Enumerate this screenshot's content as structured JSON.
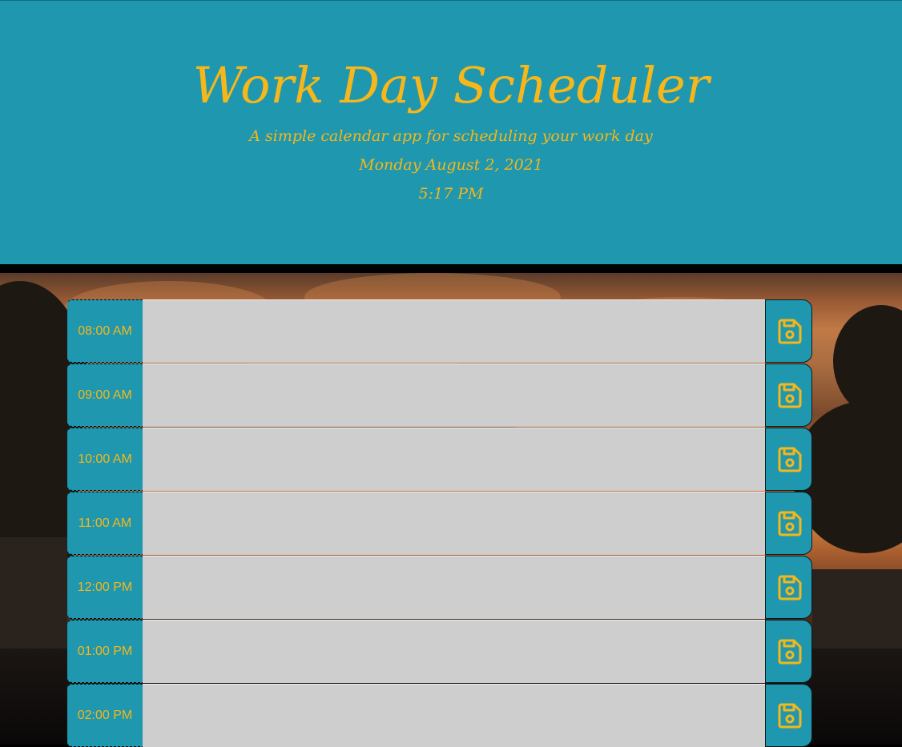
{
  "header": {
    "title": "Work Day Scheduler",
    "subtitle": "A simple calendar app for scheduling your work day",
    "date": "Monday August 2, 2021",
    "time": "5:17 PM"
  },
  "colors": {
    "accent": "#1f97ae",
    "text": "#f5b71b",
    "textarea": "#cecece"
  },
  "time_blocks": [
    {
      "hour": "08:00 AM",
      "description": "",
      "save_icon": "save-icon"
    },
    {
      "hour": "09:00 AM",
      "description": "",
      "save_icon": "save-icon"
    },
    {
      "hour": "10:00 AM",
      "description": "",
      "save_icon": "save-icon"
    },
    {
      "hour": "11:00 AM",
      "description": "",
      "save_icon": "save-icon"
    },
    {
      "hour": "12:00 PM",
      "description": "",
      "save_icon": "save-icon"
    },
    {
      "hour": "01:00 PM",
      "description": "",
      "save_icon": "save-icon"
    },
    {
      "hour": "02:00 PM",
      "description": "",
      "save_icon": "save-icon"
    }
  ]
}
